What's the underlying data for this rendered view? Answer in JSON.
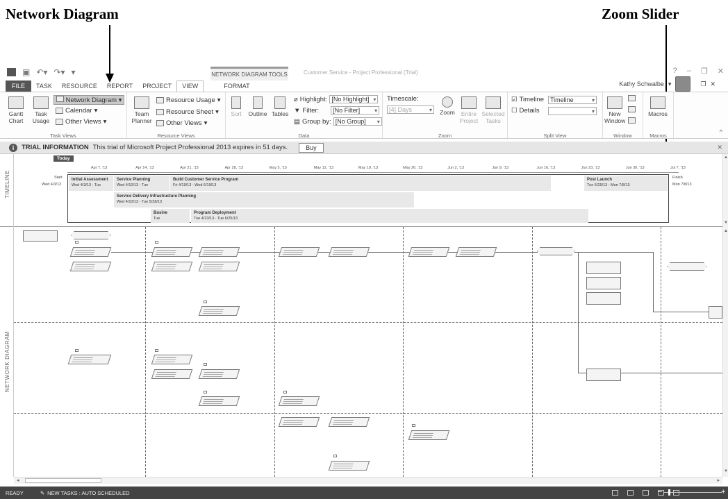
{
  "callouts": {
    "network_diagram": "Network Diagram",
    "zoom_slider": "Zoom Slider"
  },
  "titlebar": {
    "context_tab": "NETWORK DIAGRAM TOOLS",
    "window_title": "Customer Service - Project Professional (Trial)",
    "user": "Kathy Schwalbe"
  },
  "tabs": [
    "FILE",
    "TASK",
    "RESOURCE",
    "REPORT",
    "PROJECT",
    "VIEW",
    "FORMAT"
  ],
  "active_tab": "VIEW",
  "ribbon": {
    "task_views": {
      "gantt": "Gantt Chart",
      "task_usage": "Task Usage",
      "network_diagram": "Network Diagram",
      "calendar": "Calendar",
      "other_views": "Other Views",
      "group": "Task Views"
    },
    "resource_views": {
      "team_planner": "Team Planner",
      "resource_usage": "Resource Usage",
      "resource_sheet": "Resource Sheet",
      "other_views": "Other Views",
      "group": "Resource Views"
    },
    "data": {
      "sort": "Sort",
      "outline": "Outline",
      "tables": "Tables",
      "highlight_label": "Highlight:",
      "highlight_value": "[No Highlight]",
      "filter_label": "Filter:",
      "filter_value": "[No Filter]",
      "group_label": "Group by:",
      "group_value": "[No Group]",
      "group": "Data"
    },
    "zoom": {
      "timescale_label": "Timescale:",
      "timescale_value": "[4] Days",
      "zoom": "Zoom",
      "entire_project": "Entire Project",
      "selected_tasks": "Selected Tasks",
      "group": "Zoom"
    },
    "split_view": {
      "timeline_label": "Timeline",
      "timeline_value": "Timeline",
      "details_label": "Details",
      "group": "Split View"
    },
    "window": {
      "new_window": "New Window",
      "group": "Window"
    },
    "macros": {
      "macros": "Macros",
      "group": "Macros"
    }
  },
  "trial": {
    "title": "TRIAL INFORMATION",
    "message": "This trial of Microsoft Project Professional 2013 expires in 51 days.",
    "buy": "Buy"
  },
  "timeline": {
    "band_label": "TIMELINE",
    "today": "Today",
    "ticks": [
      "Apr 7, '13",
      "Apr 14, '13",
      "Apr 21, '13",
      "Apr 28, '13",
      "May 5, '13",
      "May 12, '13",
      "May 19, '13",
      "May 26, '13",
      "Jun 2, '13",
      "Jun 9, '13",
      "Jun 16, '13",
      "Jun 23, '13",
      "Jun 30, '13",
      "Jul 7, '13"
    ],
    "start_label": "Start",
    "start_date": "Wed 4/3/13",
    "finish_label": "Finish",
    "finish_date": "Mon 7/8/13",
    "bars": [
      {
        "name": "Initial Assessment",
        "dates": "Wed 4/3/13 - Tue"
      },
      {
        "name": "Service Planning",
        "dates": "Wed 4/10/13 - Tue"
      },
      {
        "name": "Build Customer Service Program",
        "dates": "Fri 4/19/13 - Wed 6/19/13"
      },
      {
        "name": "Post Launch",
        "dates": "Tue 6/25/13 - Mon 7/8/13"
      },
      {
        "name": "Service Delivery Infrastructure Planning",
        "dates": "Wed 4/10/13 - Tue 5/28/13"
      },
      {
        "name": "Busine",
        "dates": "Tue"
      },
      {
        "name": "Program Deployment",
        "dates": "Tue 4/23/13 - Tue 6/25/13"
      }
    ]
  },
  "network": {
    "band_label": "NETWORK DIAGRAM"
  },
  "status": {
    "ready": "READY",
    "new_tasks": "NEW TASKS : AUTO SCHEDULED"
  }
}
